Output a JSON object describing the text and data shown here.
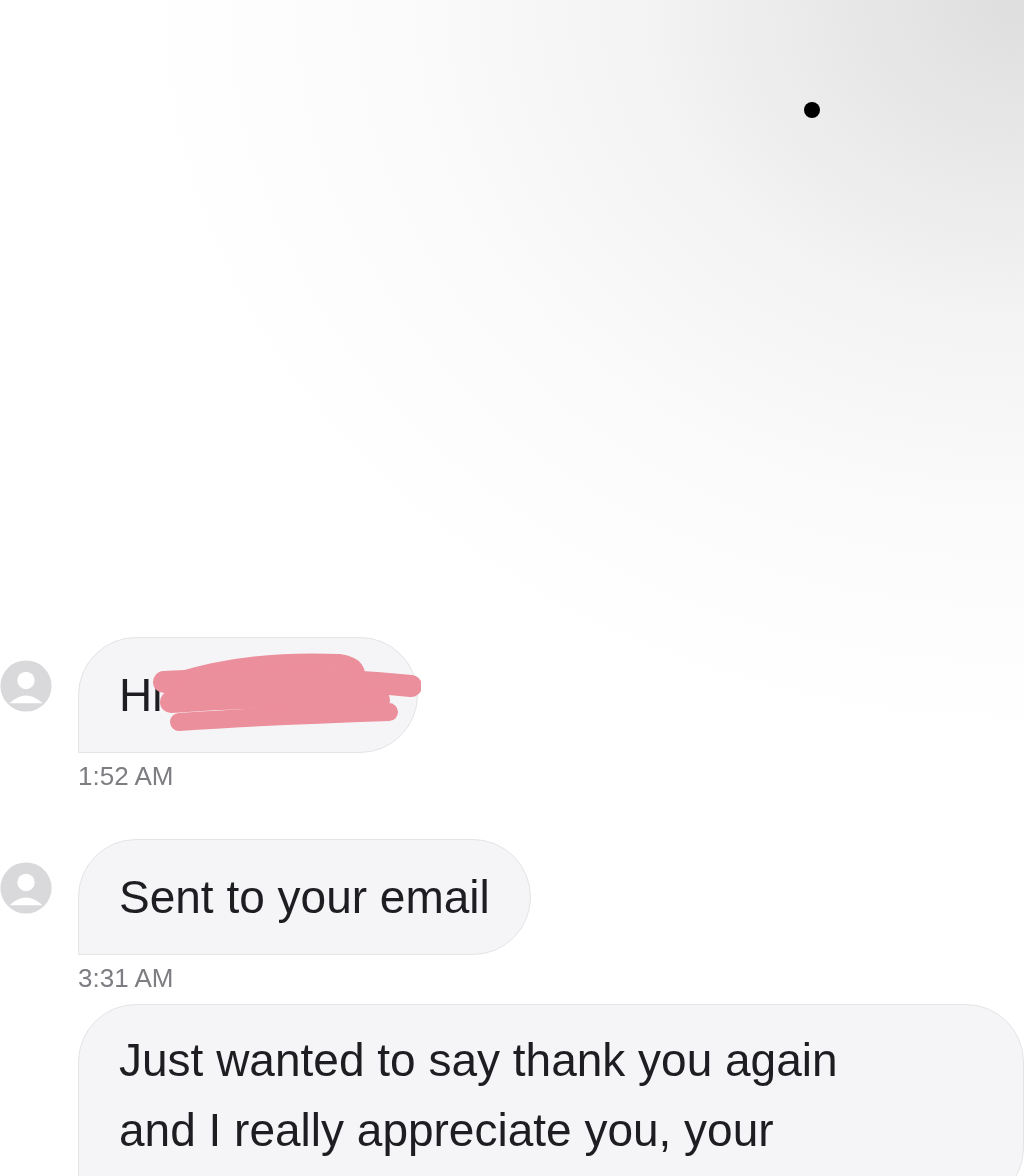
{
  "messages": [
    {
      "lines": [
        "Hi"
      ],
      "time": "1:52 AM",
      "avatar": true,
      "redacted": true
    },
    {
      "lines": [
        "Sent to your email"
      ],
      "time": "3:31 AM",
      "avatar": true,
      "redacted": false
    },
    {
      "lines": [
        "Just wanted to say thank you again",
        "and I really appreciate you, your"
      ],
      "avatar": false,
      "redacted": false
    }
  ]
}
